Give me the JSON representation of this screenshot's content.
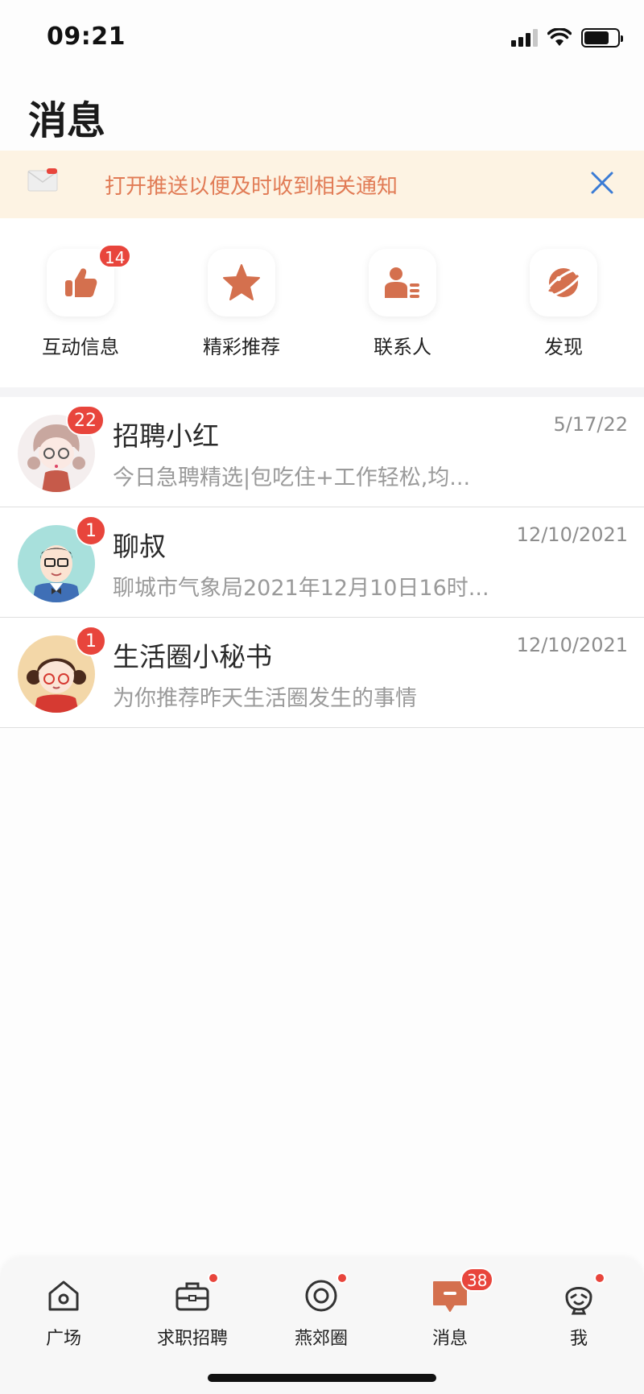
{
  "status_bar": {
    "time": "09:21"
  },
  "header": {
    "title": "消息"
  },
  "notify_banner": {
    "text": "打开推送以便及时收到相关通知"
  },
  "quick_entries": [
    {
      "label": "互动信息",
      "icon": "thumbs-up-icon",
      "badge": "14"
    },
    {
      "label": "精彩推荐",
      "icon": "star-icon",
      "badge": ""
    },
    {
      "label": "联系人",
      "icon": "contact-card-icon",
      "badge": ""
    },
    {
      "label": "发现",
      "icon": "planet-icon",
      "badge": ""
    }
  ],
  "conversations": [
    {
      "name": "招聘小红",
      "time": "5/17/22",
      "preview": "今日急聘精选|包吃住+工作轻松,均...",
      "badge": "22",
      "avatar": "girl-pigtails-avatar"
    },
    {
      "name": "聊叔",
      "time": "12/10/2021",
      "preview": "聊城市气象局2021年12月10日16时...",
      "badge": "1",
      "avatar": "man-glasses-avatar"
    },
    {
      "name": "生活圈小秘书",
      "time": "12/10/2021",
      "preview": "为你推荐昨天生活圈发生的事情",
      "badge": "1",
      "avatar": "girl-glasses-avatar"
    }
  ],
  "tab_bar": {
    "items": [
      {
        "label": "广场",
        "icon": "home-icon",
        "dot": false,
        "badge": ""
      },
      {
        "label": "求职招聘",
        "icon": "briefcase-icon",
        "dot": true,
        "badge": ""
      },
      {
        "label": "燕郊圈",
        "icon": "circle-target-icon",
        "dot": true,
        "badge": ""
      },
      {
        "label": "消息",
        "icon": "message-icon",
        "dot": false,
        "badge": "38",
        "active": true
      },
      {
        "label": "我",
        "icon": "smile-face-icon",
        "dot": true,
        "badge": ""
      }
    ]
  },
  "colors": {
    "accent": "#d4704e",
    "badge": "#e8453c",
    "banner_bg": "#fdf3e3",
    "banner_text": "#e17b55",
    "close_icon": "#3a7bd5"
  }
}
